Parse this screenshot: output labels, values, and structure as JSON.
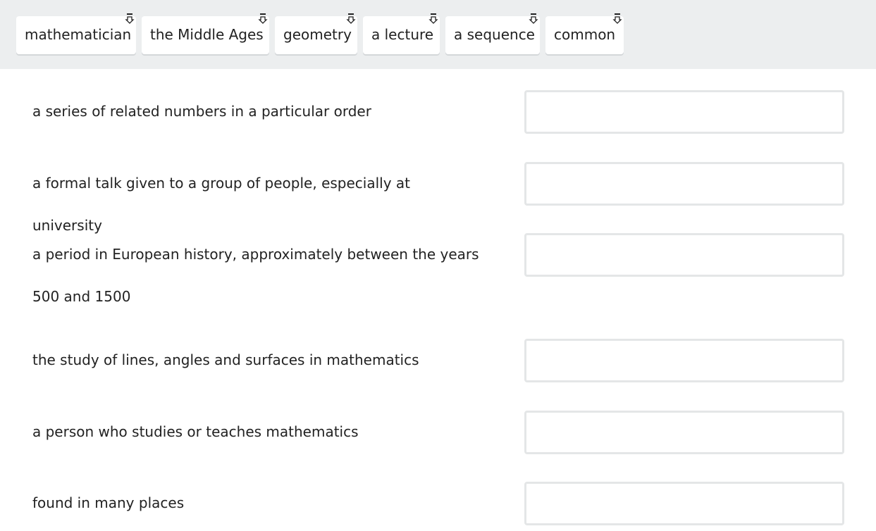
{
  "word_bank": {
    "chips": [
      {
        "label": "mathematician",
        "icon": "drag-handle-icon"
      },
      {
        "label": "the Middle Ages",
        "icon": "drag-handle-icon"
      },
      {
        "label": "geometry",
        "icon": "drag-handle-icon"
      },
      {
        "label": "a lecture",
        "icon": "drag-handle-icon"
      },
      {
        "label": "a sequence",
        "icon": "drag-handle-icon"
      },
      {
        "label": "common",
        "icon": "drag-handle-icon"
      }
    ]
  },
  "definitions": [
    {
      "text": "a series of related numbers in a particular order",
      "answer": ""
    },
    {
      "text": "a formal talk given to a group of people, especially at university",
      "answer": ""
    },
    {
      "text": "a period in European history, approximately between the years 500 and 1500",
      "answer": ""
    },
    {
      "text": "the study of lines, angles and surfaces in mathematics",
      "answer": ""
    },
    {
      "text": "a person who studies or teaches mathematics",
      "answer": ""
    },
    {
      "text": "found in many places",
      "answer": ""
    }
  ],
  "colors": {
    "bank_background": "#eceeef",
    "chip_background": "#ffffff",
    "drop_box_border": "#e4e6e7",
    "text": "#222222"
  }
}
